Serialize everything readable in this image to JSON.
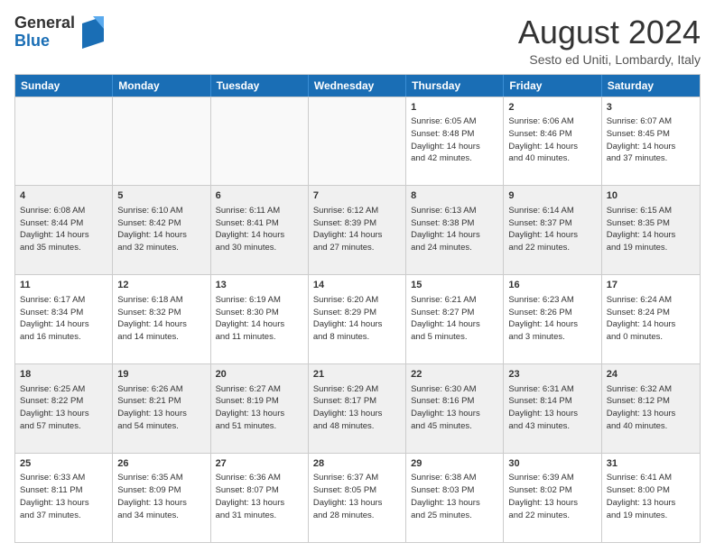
{
  "logo": {
    "general": "General",
    "blue": "Blue"
  },
  "header": {
    "month_year": "August 2024",
    "location": "Sesto ed Uniti, Lombardy, Italy"
  },
  "days": [
    "Sunday",
    "Monday",
    "Tuesday",
    "Wednesday",
    "Thursday",
    "Friday",
    "Saturday"
  ],
  "rows": [
    [
      {
        "day": "",
        "text": "",
        "empty": true
      },
      {
        "day": "",
        "text": "",
        "empty": true
      },
      {
        "day": "",
        "text": "",
        "empty": true
      },
      {
        "day": "",
        "text": "",
        "empty": true
      },
      {
        "day": "1",
        "text": "Sunrise: 6:05 AM\nSunset: 8:48 PM\nDaylight: 14 hours\nand 42 minutes."
      },
      {
        "day": "2",
        "text": "Sunrise: 6:06 AM\nSunset: 8:46 PM\nDaylight: 14 hours\nand 40 minutes."
      },
      {
        "day": "3",
        "text": "Sunrise: 6:07 AM\nSunset: 8:45 PM\nDaylight: 14 hours\nand 37 minutes."
      }
    ],
    [
      {
        "day": "4",
        "text": "Sunrise: 6:08 AM\nSunset: 8:44 PM\nDaylight: 14 hours\nand 35 minutes."
      },
      {
        "day": "5",
        "text": "Sunrise: 6:10 AM\nSunset: 8:42 PM\nDaylight: 14 hours\nand 32 minutes."
      },
      {
        "day": "6",
        "text": "Sunrise: 6:11 AM\nSunset: 8:41 PM\nDaylight: 14 hours\nand 30 minutes."
      },
      {
        "day": "7",
        "text": "Sunrise: 6:12 AM\nSunset: 8:39 PM\nDaylight: 14 hours\nand 27 minutes."
      },
      {
        "day": "8",
        "text": "Sunrise: 6:13 AM\nSunset: 8:38 PM\nDaylight: 14 hours\nand 24 minutes."
      },
      {
        "day": "9",
        "text": "Sunrise: 6:14 AM\nSunset: 8:37 PM\nDaylight: 14 hours\nand 22 minutes."
      },
      {
        "day": "10",
        "text": "Sunrise: 6:15 AM\nSunset: 8:35 PM\nDaylight: 14 hours\nand 19 minutes."
      }
    ],
    [
      {
        "day": "11",
        "text": "Sunrise: 6:17 AM\nSunset: 8:34 PM\nDaylight: 14 hours\nand 16 minutes."
      },
      {
        "day": "12",
        "text": "Sunrise: 6:18 AM\nSunset: 8:32 PM\nDaylight: 14 hours\nand 14 minutes."
      },
      {
        "day": "13",
        "text": "Sunrise: 6:19 AM\nSunset: 8:30 PM\nDaylight: 14 hours\nand 11 minutes."
      },
      {
        "day": "14",
        "text": "Sunrise: 6:20 AM\nSunset: 8:29 PM\nDaylight: 14 hours\nand 8 minutes."
      },
      {
        "day": "15",
        "text": "Sunrise: 6:21 AM\nSunset: 8:27 PM\nDaylight: 14 hours\nand 5 minutes."
      },
      {
        "day": "16",
        "text": "Sunrise: 6:23 AM\nSunset: 8:26 PM\nDaylight: 14 hours\nand 3 minutes."
      },
      {
        "day": "17",
        "text": "Sunrise: 6:24 AM\nSunset: 8:24 PM\nDaylight: 14 hours\nand 0 minutes."
      }
    ],
    [
      {
        "day": "18",
        "text": "Sunrise: 6:25 AM\nSunset: 8:22 PM\nDaylight: 13 hours\nand 57 minutes."
      },
      {
        "day": "19",
        "text": "Sunrise: 6:26 AM\nSunset: 8:21 PM\nDaylight: 13 hours\nand 54 minutes."
      },
      {
        "day": "20",
        "text": "Sunrise: 6:27 AM\nSunset: 8:19 PM\nDaylight: 13 hours\nand 51 minutes."
      },
      {
        "day": "21",
        "text": "Sunrise: 6:29 AM\nSunset: 8:17 PM\nDaylight: 13 hours\nand 48 minutes."
      },
      {
        "day": "22",
        "text": "Sunrise: 6:30 AM\nSunset: 8:16 PM\nDaylight: 13 hours\nand 45 minutes."
      },
      {
        "day": "23",
        "text": "Sunrise: 6:31 AM\nSunset: 8:14 PM\nDaylight: 13 hours\nand 43 minutes."
      },
      {
        "day": "24",
        "text": "Sunrise: 6:32 AM\nSunset: 8:12 PM\nDaylight: 13 hours\nand 40 minutes."
      }
    ],
    [
      {
        "day": "25",
        "text": "Sunrise: 6:33 AM\nSunset: 8:11 PM\nDaylight: 13 hours\nand 37 minutes."
      },
      {
        "day": "26",
        "text": "Sunrise: 6:35 AM\nSunset: 8:09 PM\nDaylight: 13 hours\nand 34 minutes."
      },
      {
        "day": "27",
        "text": "Sunrise: 6:36 AM\nSunset: 8:07 PM\nDaylight: 13 hours\nand 31 minutes."
      },
      {
        "day": "28",
        "text": "Sunrise: 6:37 AM\nSunset: 8:05 PM\nDaylight: 13 hours\nand 28 minutes."
      },
      {
        "day": "29",
        "text": "Sunrise: 6:38 AM\nSunset: 8:03 PM\nDaylight: 13 hours\nand 25 minutes."
      },
      {
        "day": "30",
        "text": "Sunrise: 6:39 AM\nSunset: 8:02 PM\nDaylight: 13 hours\nand 22 minutes."
      },
      {
        "day": "31",
        "text": "Sunrise: 6:41 AM\nSunset: 8:00 PM\nDaylight: 13 hours\nand 19 minutes."
      }
    ]
  ]
}
